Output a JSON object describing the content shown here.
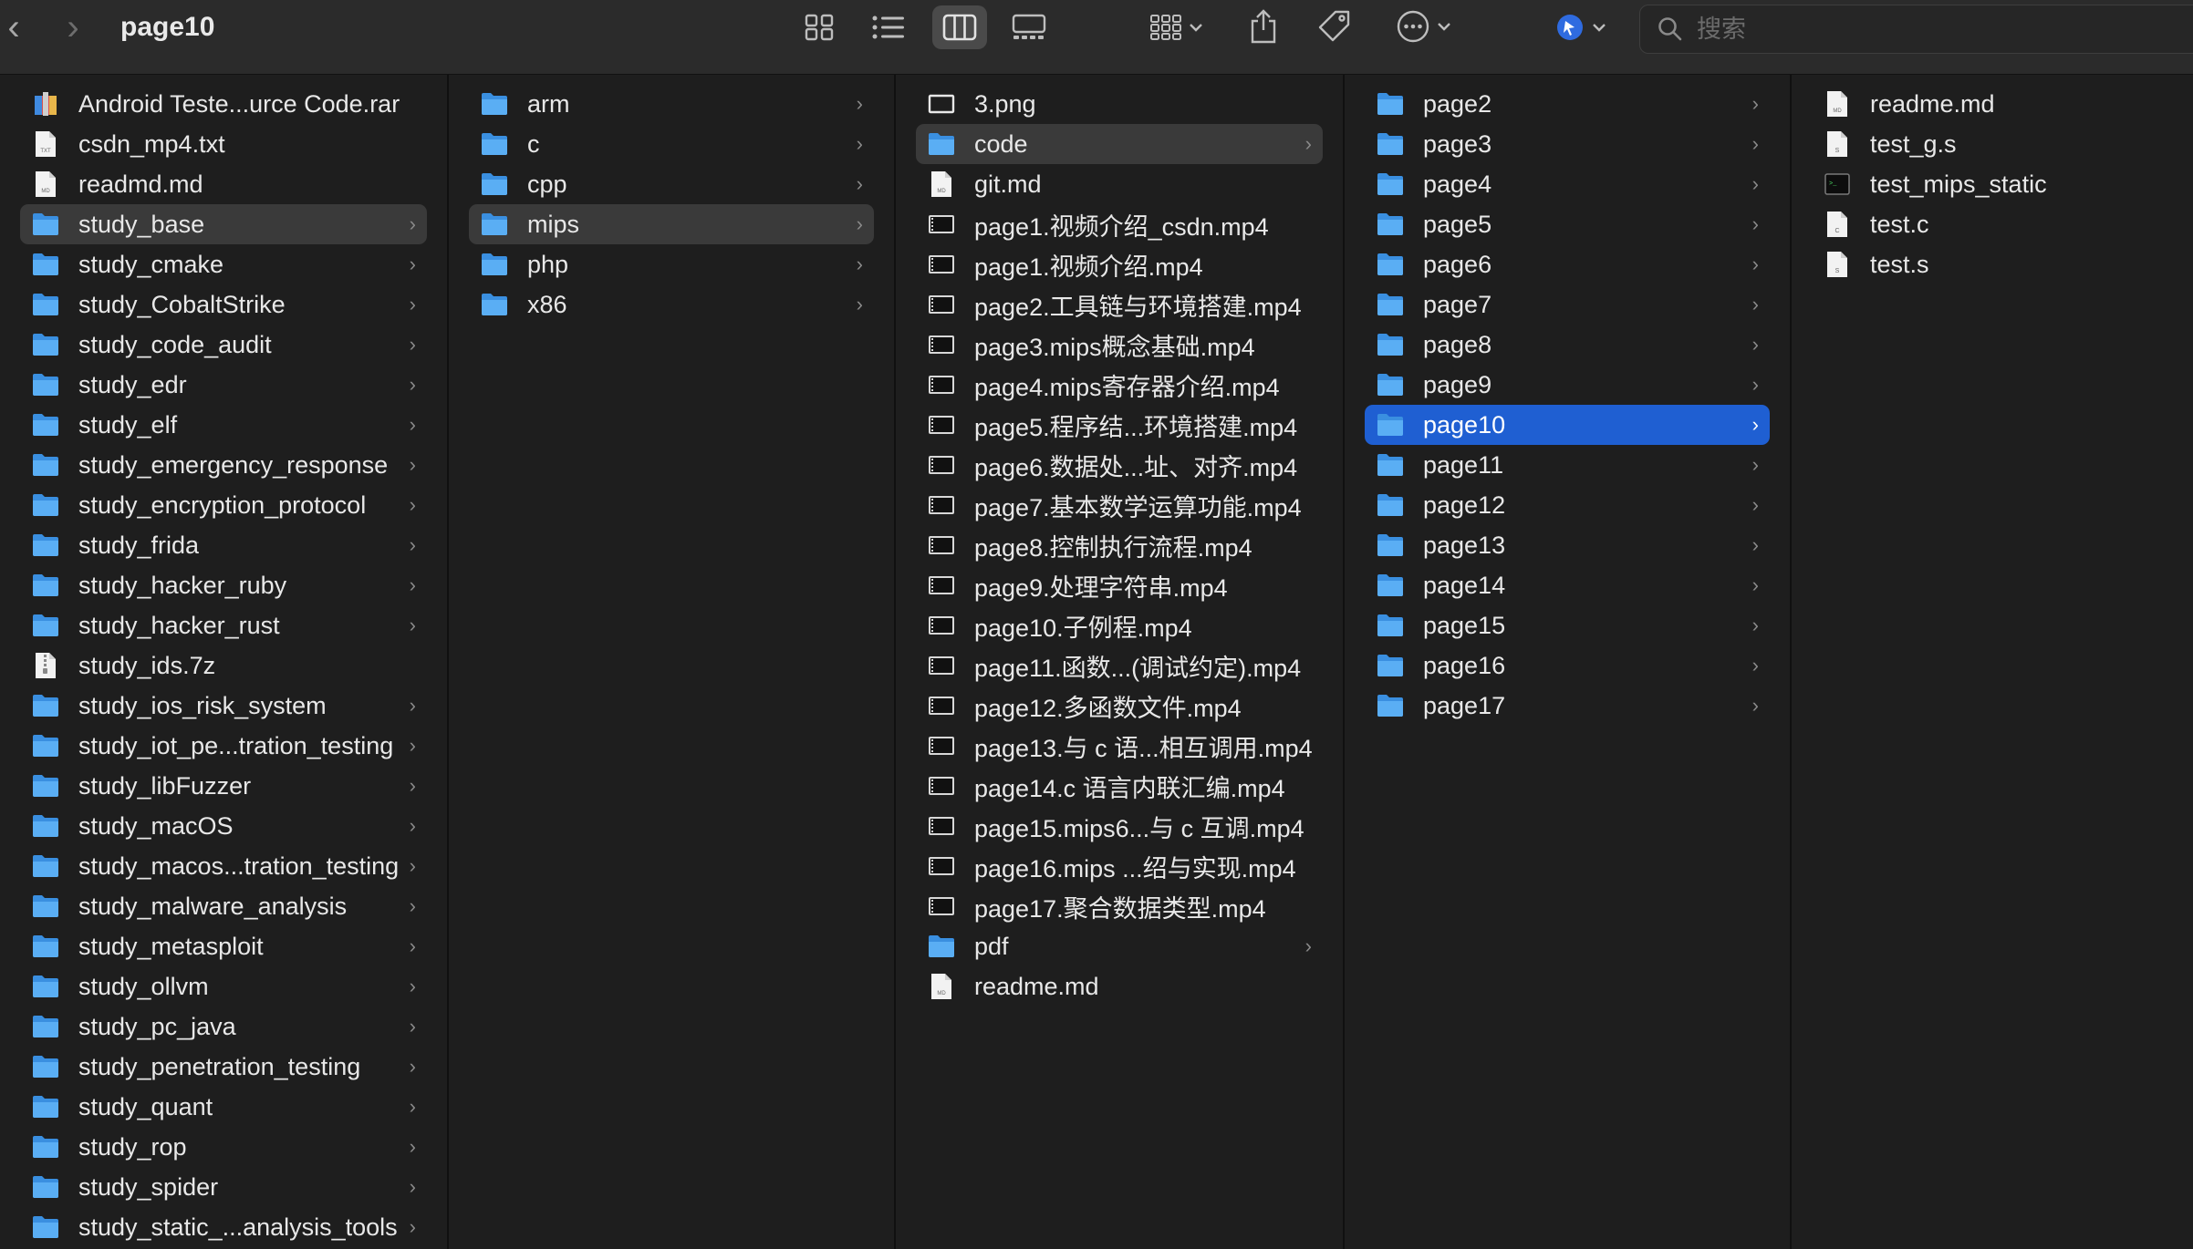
{
  "window": {
    "title": "page10",
    "search_placeholder": "搜索"
  },
  "toolbar": {
    "buttons": [
      "icon-view",
      "list-view",
      "column-view",
      "gallery-view",
      "group-by",
      "share",
      "tags",
      "more-actions",
      "connect-app"
    ],
    "active_view": "column-view"
  },
  "columns": [
    {
      "name": "study-column",
      "items": [
        {
          "label": "Android Teste...urce Code.rar",
          "icon": "archive-icon",
          "folder": false
        },
        {
          "label": "csdn_mp4.txt",
          "icon": "txt-file-icon",
          "folder": false
        },
        {
          "label": "readmd.md",
          "icon": "md-file-icon",
          "folder": false
        },
        {
          "label": "study_base",
          "icon": "folder-icon",
          "folder": true,
          "state": "selected"
        },
        {
          "label": "study_cmake",
          "icon": "folder-icon",
          "folder": true
        },
        {
          "label": "study_CobaltStrike",
          "icon": "folder-icon",
          "folder": true
        },
        {
          "label": "study_code_audit",
          "icon": "folder-icon",
          "folder": true
        },
        {
          "label": "study_edr",
          "icon": "folder-icon",
          "folder": true
        },
        {
          "label": "study_elf",
          "icon": "folder-icon",
          "folder": true
        },
        {
          "label": "study_emergency_response",
          "icon": "folder-icon",
          "folder": true
        },
        {
          "label": "study_encryption_protocol",
          "icon": "folder-icon",
          "folder": true
        },
        {
          "label": "study_frida",
          "icon": "folder-icon",
          "folder": true
        },
        {
          "label": "study_hacker_ruby",
          "icon": "folder-icon",
          "folder": true
        },
        {
          "label": "study_hacker_rust",
          "icon": "folder-icon",
          "folder": true
        },
        {
          "label": "study_ids.7z",
          "icon": "archive-file-icon",
          "folder": false
        },
        {
          "label": "study_ios_risk_system",
          "icon": "folder-icon",
          "folder": true
        },
        {
          "label": "study_iot_pe...tration_testing",
          "icon": "folder-icon",
          "folder": true
        },
        {
          "label": "study_libFuzzer",
          "icon": "folder-icon",
          "folder": true
        },
        {
          "label": "study_macOS",
          "icon": "folder-icon",
          "folder": true
        },
        {
          "label": "study_macos...tration_testing",
          "icon": "folder-icon",
          "folder": true
        },
        {
          "label": "study_malware_analysis",
          "icon": "folder-icon",
          "folder": true
        },
        {
          "label": "study_metasploit",
          "icon": "folder-icon",
          "folder": true
        },
        {
          "label": "study_ollvm",
          "icon": "folder-icon",
          "folder": true
        },
        {
          "label": "study_pc_java",
          "icon": "folder-icon",
          "folder": true
        },
        {
          "label": "study_penetration_testing",
          "icon": "folder-icon",
          "folder": true
        },
        {
          "label": "study_quant",
          "icon": "folder-icon",
          "folder": true
        },
        {
          "label": "study_rop",
          "icon": "folder-icon",
          "folder": true
        },
        {
          "label": "study_spider",
          "icon": "folder-icon",
          "folder": true
        },
        {
          "label": "study_static_...analysis_tools",
          "icon": "folder-icon",
          "folder": true
        }
      ]
    },
    {
      "name": "arch-column",
      "items": [
        {
          "label": "arm",
          "icon": "folder-icon",
          "folder": true
        },
        {
          "label": "c",
          "icon": "folder-icon",
          "folder": true
        },
        {
          "label": "cpp",
          "icon": "folder-icon",
          "folder": true
        },
        {
          "label": "mips",
          "icon": "folder-icon",
          "folder": true,
          "state": "selected"
        },
        {
          "label": "php",
          "icon": "folder-icon",
          "folder": true
        },
        {
          "label": "x86",
          "icon": "folder-icon",
          "folder": true
        }
      ]
    },
    {
      "name": "mips-column",
      "items": [
        {
          "label": "3.png",
          "icon": "image-file-icon",
          "folder": false
        },
        {
          "label": "code",
          "icon": "folder-icon",
          "folder": true,
          "state": "selected"
        },
        {
          "label": "git.md",
          "icon": "md-file-icon",
          "folder": false
        },
        {
          "label": "page1.视频介绍_csdn.mp4",
          "icon": "video-file-icon",
          "folder": false
        },
        {
          "label": "page1.视频介绍.mp4",
          "icon": "video-file-icon",
          "folder": false
        },
        {
          "label": "page2.工具链与环境搭建.mp4",
          "icon": "video-file-icon",
          "folder": false
        },
        {
          "label": "page3.mips概念基础.mp4",
          "icon": "video-file-icon",
          "folder": false
        },
        {
          "label": "page4.mips寄存器介绍.mp4",
          "icon": "video-file-icon",
          "folder": false
        },
        {
          "label": "page5.程序结...环境搭建.mp4",
          "icon": "video-file-icon",
          "folder": false
        },
        {
          "label": "page6.数据处...址、对齐.mp4",
          "icon": "video-file-icon",
          "folder": false
        },
        {
          "label": "page7.基本数学运算功能.mp4",
          "icon": "video-file-icon",
          "folder": false
        },
        {
          "label": "page8.控制执行流程.mp4",
          "icon": "video-file-icon",
          "folder": false
        },
        {
          "label": "page9.处理字符串.mp4",
          "icon": "video-file-icon",
          "folder": false
        },
        {
          "label": "page10.子例程.mp4",
          "icon": "video-file-icon",
          "folder": false
        },
        {
          "label": "page11.函数...(调试约定).mp4",
          "icon": "video-file-icon",
          "folder": false
        },
        {
          "label": "page12.多函数文件.mp4",
          "icon": "video-file-icon",
          "folder": false
        },
        {
          "label": "page13.与 c 语...相互调用.mp4",
          "icon": "video-file-icon",
          "folder": false
        },
        {
          "label": "page14.c 语言内联汇编.mp4",
          "icon": "video-file-icon",
          "folder": false
        },
        {
          "label": "page15.mips6...与 c 互调.mp4",
          "icon": "video-file-icon",
          "folder": false
        },
        {
          "label": "page16.mips ...绍与实现.mp4",
          "icon": "video-file-icon",
          "folder": false
        },
        {
          "label": "page17.聚合数据类型.mp4",
          "icon": "video-file-icon",
          "folder": false
        },
        {
          "label": "pdf",
          "icon": "folder-icon",
          "folder": true
        },
        {
          "label": "readme.md",
          "icon": "md-file-icon",
          "folder": false
        }
      ]
    },
    {
      "name": "code-column",
      "items": [
        {
          "label": "page2",
          "icon": "folder-icon",
          "folder": true
        },
        {
          "label": "page3",
          "icon": "folder-icon",
          "folder": true
        },
        {
          "label": "page4",
          "icon": "folder-icon",
          "folder": true
        },
        {
          "label": "page5",
          "icon": "folder-icon",
          "folder": true
        },
        {
          "label": "page6",
          "icon": "folder-icon",
          "folder": true
        },
        {
          "label": "page7",
          "icon": "folder-icon",
          "folder": true
        },
        {
          "label": "page8",
          "icon": "folder-icon",
          "folder": true
        },
        {
          "label": "page9",
          "icon": "folder-icon",
          "folder": true
        },
        {
          "label": "page10",
          "icon": "folder-icon",
          "folder": true,
          "state": "active"
        },
        {
          "label": "page11",
          "icon": "folder-icon",
          "folder": true
        },
        {
          "label": "page12",
          "icon": "folder-icon",
          "folder": true
        },
        {
          "label": "page13",
          "icon": "folder-icon",
          "folder": true
        },
        {
          "label": "page14",
          "icon": "folder-icon",
          "folder": true
        },
        {
          "label": "page15",
          "icon": "folder-icon",
          "folder": true
        },
        {
          "label": "page16",
          "icon": "folder-icon",
          "folder": true
        },
        {
          "label": "page17",
          "icon": "folder-icon",
          "folder": true
        }
      ]
    },
    {
      "name": "page10-column",
      "items": [
        {
          "label": "readme.md",
          "icon": "md-file-icon",
          "folder": false
        },
        {
          "label": "test_g.s",
          "icon": "s-file-icon",
          "folder": false
        },
        {
          "label": "test_mips_static",
          "icon": "executable-icon",
          "folder": false
        },
        {
          "label": "test.c",
          "icon": "c-file-icon",
          "folder": false
        },
        {
          "label": "test.s",
          "icon": "s-file-icon",
          "folder": false
        }
      ]
    }
  ],
  "colors": {
    "background": "#1e1e1e",
    "toolbar": "#2b2b2b",
    "folder": "#4aa3f0",
    "selection_inactive": "#3a3a3a",
    "selection_active": "#1f5fd2"
  }
}
